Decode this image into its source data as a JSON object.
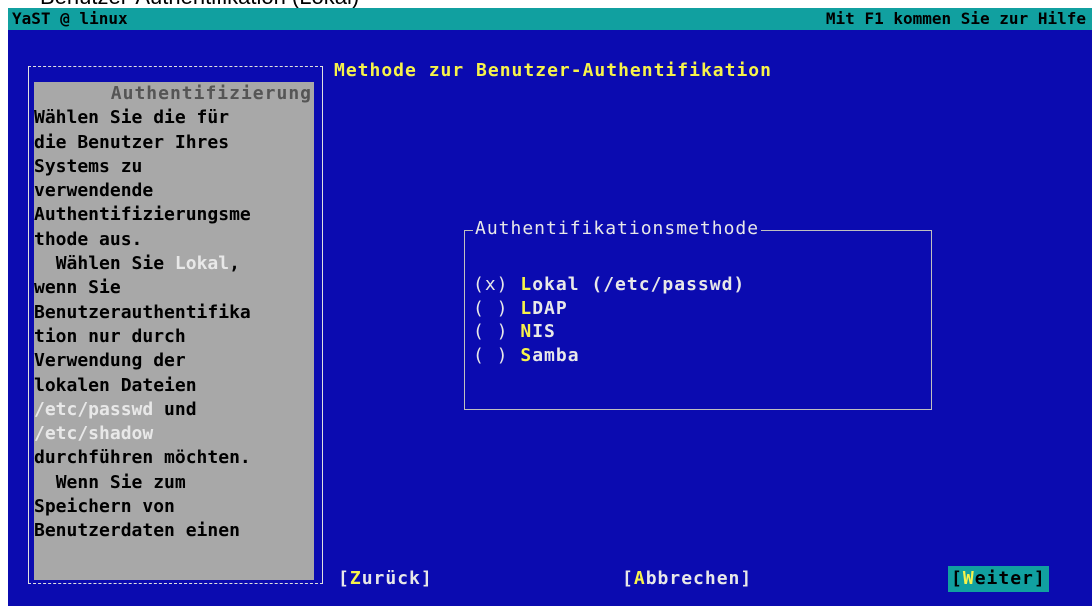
{
  "window_caption": "Benutzer-Authentifikation (Lokal)",
  "topbar": {
    "left": "YaST @ linux",
    "right": "Mit F1 kommen Sie zur Hilfe"
  },
  "help": {
    "title": "Authentifizierung",
    "lines": [
      "Wählen Sie die für",
      "die Benutzer Ihres",
      "Systems zu",
      "verwendende",
      "Authentifizierungsme",
      "thode aus.",
      "  Wählen Sie |Lokal|,",
      "wenn Sie",
      "Benutzerauthentifika",
      "tion nur durch",
      "Verwendung der",
      "lokalen Dateien",
      "|/etc/passwd| und",
      "|/etc/shadow|",
      "durchführen möchten.",
      "  Wenn Sie zum",
      "Speichern von",
      "Benutzerdaten einen"
    ]
  },
  "page_title": "Methode zur Benutzer-Authentifikation",
  "group": {
    "title": "Authentifikationsmethode",
    "options": [
      {
        "mark": "(x)",
        "key": "L",
        "rest": "okal (/etc/passwd)",
        "selected": true
      },
      {
        "mark": "( )",
        "key": "L",
        "rest": "DAP",
        "selected": false
      },
      {
        "mark": "( )",
        "key": "N",
        "rest": "IS",
        "selected": false
      },
      {
        "mark": "( )",
        "key": "S",
        "rest": "amba",
        "selected": false
      }
    ]
  },
  "buttons": {
    "back": {
      "pre": "[",
      "key": "Z",
      "post": "urück]"
    },
    "abort": {
      "pre": "[",
      "key": "A",
      "post": "bbrechen]"
    },
    "next": {
      "pre": "[",
      "key": "W",
      "post": "eiter]"
    }
  },
  "colors": {
    "background": "#0b0bb0",
    "accent": "#11a0a0",
    "highlight": "#f7f34a",
    "help_bg": "#a8a8a8"
  }
}
